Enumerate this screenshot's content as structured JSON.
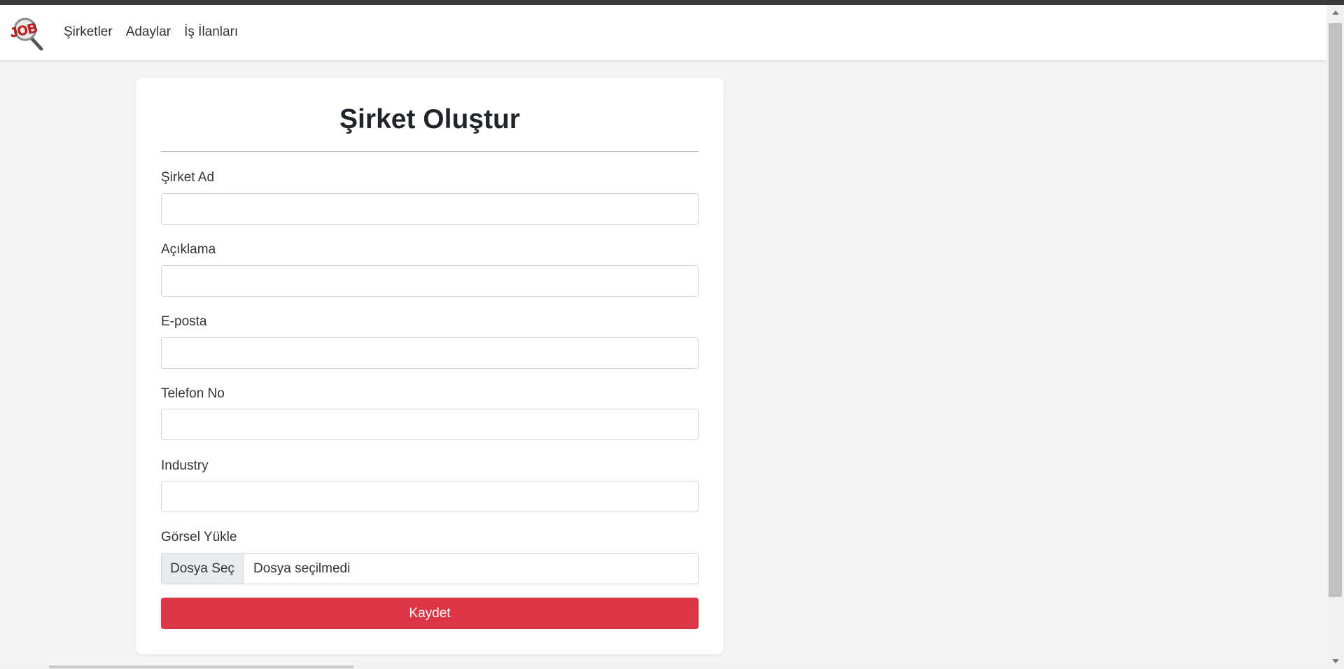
{
  "navbar": {
    "logo_text": "JOB",
    "links": [
      {
        "label": "Şirketler"
      },
      {
        "label": "Adaylar"
      },
      {
        "label": "İş İlanları"
      }
    ]
  },
  "form": {
    "title": "Şirket Oluştur",
    "fields": [
      {
        "label": "Şirket Ad",
        "value": ""
      },
      {
        "label": "Açıklama",
        "value": ""
      },
      {
        "label": "E-posta",
        "value": ""
      },
      {
        "label": "Telefon No",
        "value": ""
      },
      {
        "label": "Industry",
        "value": ""
      }
    ],
    "file_upload": {
      "label": "Görsel Yükle",
      "button_label": "Dosya Seç",
      "status_text": "Dosya seçilmedi"
    },
    "submit_label": "Kaydet"
  },
  "colors": {
    "accent_red": "#dc3545",
    "page_background": "#f4f4f4"
  }
}
